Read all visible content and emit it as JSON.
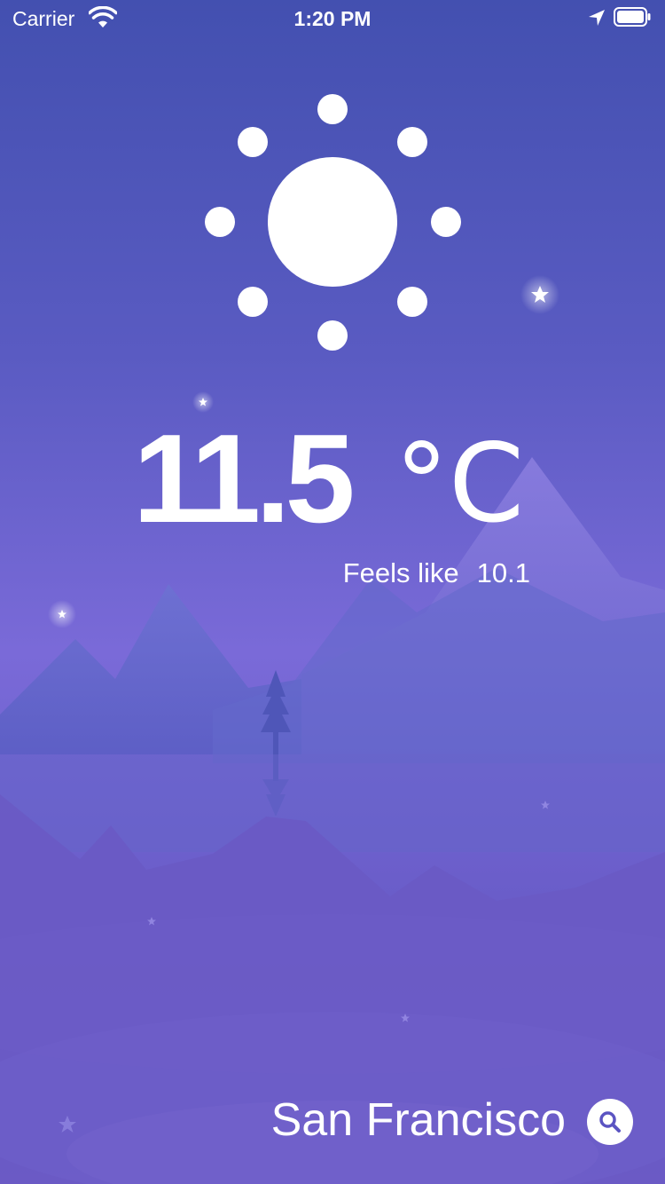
{
  "status_bar": {
    "carrier": "Carrier",
    "time": "1:20 PM",
    "icons": [
      "wifi-icon",
      "location-arrow-icon",
      "battery-icon"
    ]
  },
  "weather": {
    "condition_icon": "sun-icon",
    "temperature": "11.5",
    "unit": "°C",
    "feels_like_label": "Feels like",
    "feels_like_value": "10.1"
  },
  "location": {
    "city": "San Francisco",
    "search_icon": "search-icon"
  },
  "colors": {
    "sky_top": "#4350b0",
    "sky_mid": "#7a6ad8",
    "text": "#ffffff"
  }
}
